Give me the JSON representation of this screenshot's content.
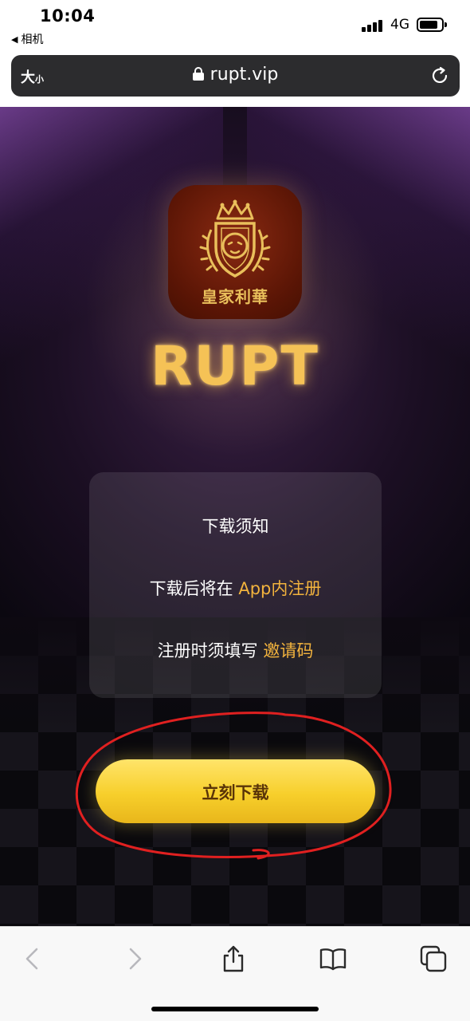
{
  "status_bar": {
    "time": "10:04",
    "back_app": "相机",
    "network": "4G"
  },
  "url_bar": {
    "text_size_big": "大",
    "text_size_small": "小",
    "url": "rupt.vip"
  },
  "page": {
    "logo_text": "皇家利華",
    "brand": "RUPT",
    "notice": {
      "title": "下载须知",
      "line1_prefix": "下载后将在 ",
      "line1_highlight": "App内注册",
      "line2_prefix": "注册时须填写 ",
      "line2_highlight": "邀请码"
    },
    "download_button": "立刻下载"
  },
  "colors": {
    "accent_gold": "#f2b33d",
    "button_yellow": "#f7cf2b",
    "annotation_red": "#e02020"
  },
  "toolbar": {
    "icons": [
      "back-icon",
      "forward-icon",
      "share-icon",
      "bookmarks-icon",
      "tabs-icon"
    ]
  }
}
